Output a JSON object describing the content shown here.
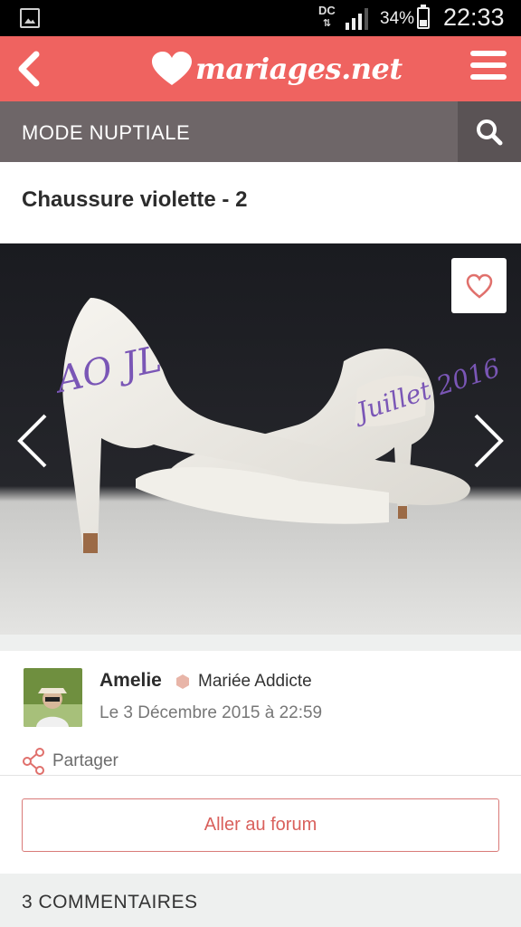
{
  "status_bar": {
    "network": "DC",
    "battery": "34%",
    "time": "22:33"
  },
  "app_bar": {
    "logo_text": "mariages.net",
    "back_icon": "chevron-left-icon",
    "menu_icon": "hamburger-icon"
  },
  "section": {
    "title": "MODE NUPTIALE",
    "search_icon": "search-icon"
  },
  "post": {
    "title": "Chaussure violette - 2",
    "photo_text_left": "AO JL",
    "photo_text_right": "Juillet 2016"
  },
  "author": {
    "name": "Amelie",
    "rank": "Mariée Addicte",
    "date": "Le 3 Décembre 2015 à 22:59",
    "share_label": "Partager"
  },
  "actions": {
    "forum_button": "Aller au forum"
  },
  "comments": {
    "title": "3 COMMENTAIRES"
  },
  "colors": {
    "brand": "#ef6360",
    "section_bar": "#6e6668",
    "accent_text": "#d9605c"
  }
}
